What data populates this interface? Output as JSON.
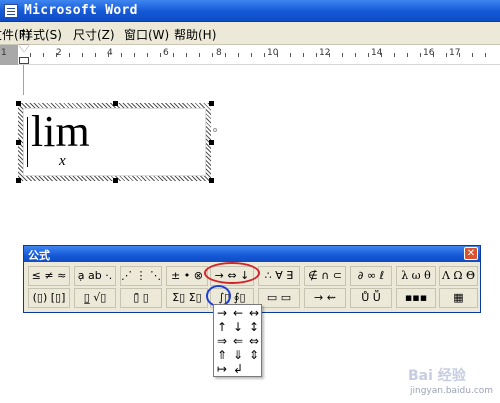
{
  "window": {
    "title": "Microsoft Word"
  },
  "menu": {
    "items": [
      "文件(F)",
      "样式(S)",
      "尺寸(Z)",
      "窗口(W)",
      "帮助(H)"
    ]
  },
  "ruler": {
    "numbers": [
      "1",
      "2",
      "4",
      "6",
      "8",
      "10",
      "12",
      "14",
      "16",
      "17"
    ]
  },
  "equation": {
    "main": "lim",
    "sub": "x"
  },
  "toolbar": {
    "title": "公式",
    "close": "✕",
    "row1": [
      "≤ ≠ ≈",
      "ạ ab ·.",
      "⋰ ⋮ ⋱",
      "± • ⊗",
      "→ ⇔ ↓",
      "∴ ∀ ∃",
      "∉ ∩ ⊂",
      "∂ ∞ ℓ",
      "λ ω θ",
      "Λ Ω Θ"
    ],
    "row2": [
      "(▯) [▯]",
      "▯̲ √▯",
      "▯̄ ▯",
      "Σ▯ Σ▯",
      "∫▯ ∮▯",
      "▭ ▭",
      "→ ⇜",
      "Ů Ṻ",
      "▪▪▪",
      "▦"
    ]
  },
  "palette": {
    "rows": [
      [
        "→",
        "←",
        "↔"
      ],
      [
        "↑",
        "↓",
        "↕"
      ],
      [
        "⇒",
        "⇐",
        "⇔"
      ],
      [
        "⇑",
        "⇓",
        "⇕"
      ],
      [
        "↦",
        "↲",
        ""
      ]
    ]
  },
  "watermark": {
    "brand": "Bai 经验",
    "url": "jingyan.baidu.com"
  },
  "colors": {
    "title_blue": "#1558d6",
    "highlight_red": "#d0242a",
    "highlight_blue": "#1e3fd6",
    "chrome": "#ece9d8"
  }
}
